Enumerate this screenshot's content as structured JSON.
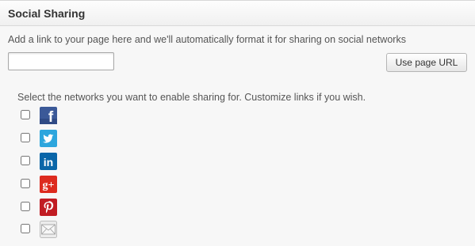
{
  "header": {
    "title": "Social Sharing"
  },
  "link_section": {
    "instructions": "Add a link to your page here and we'll automatically format it for sharing on social networks",
    "url_value": "",
    "use_page_url_label": "Use page URL"
  },
  "networks_section": {
    "instructions": "Select the networks you want to enable sharing for. Customize links if you wish.",
    "networks": [
      {
        "name": "facebook",
        "icon": "facebook-icon",
        "color": "#3b5998",
        "checked": false
      },
      {
        "name": "twitter",
        "icon": "twitter-icon",
        "color": "#2da6dd",
        "checked": false
      },
      {
        "name": "linkedin",
        "icon": "linkedin-icon",
        "color": "#0a66a8",
        "checked": false
      },
      {
        "name": "google-plus",
        "icon": "google-plus-icon",
        "color": "#dd2b1f",
        "checked": false
      },
      {
        "name": "pinterest",
        "icon": "pinterest-icon",
        "color": "#c11c23",
        "checked": false
      },
      {
        "name": "email",
        "icon": "email-icon",
        "color": "#e4e4e4",
        "checked": false
      }
    ],
    "icon_glyphs": {
      "facebook": "f",
      "linkedin": "in",
      "google_plus": "g+"
    }
  }
}
